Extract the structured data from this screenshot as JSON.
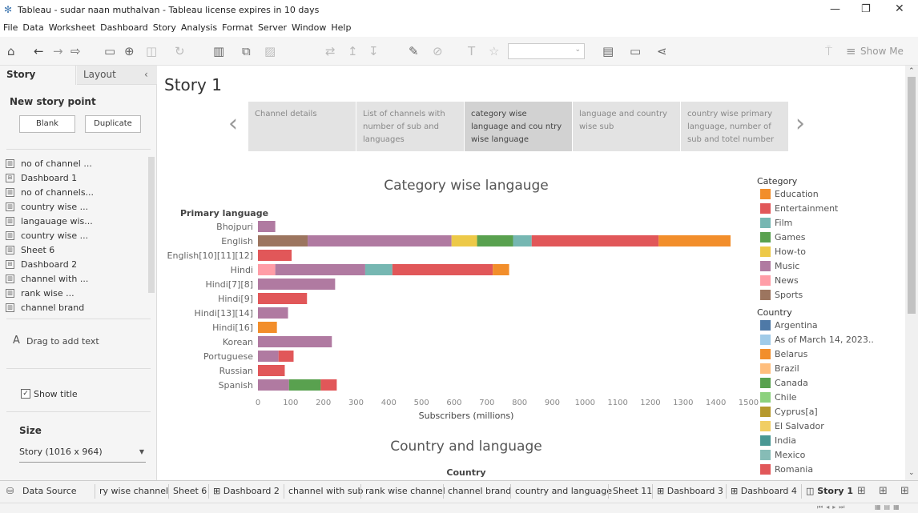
{
  "window": {
    "title": "Tableau - sudar naan muthalvan - Tableau license expires in 10 days"
  },
  "menu": [
    "File",
    "Data",
    "Worksheet",
    "Dashboard",
    "Story",
    "Analysis",
    "Format",
    "Server",
    "Window",
    "Help"
  ],
  "toolbar": {
    "show_me": "Show Me"
  },
  "sidebar": {
    "tabs": [
      "Story",
      "Layout"
    ],
    "new_story_point": "New story point",
    "blank": "Blank",
    "duplicate": "Duplicate",
    "sheets": [
      {
        "label": "no of channel ...",
        "icon": "sheet"
      },
      {
        "label": "Dashboard 1",
        "icon": "dashboard"
      },
      {
        "label": "no of channels...",
        "icon": "sheet"
      },
      {
        "label": "country wise ...",
        "icon": "sheet"
      },
      {
        "label": "langauage wis...",
        "icon": "sheet"
      },
      {
        "label": "country wise ...",
        "icon": "sheet"
      },
      {
        "label": "Sheet 6",
        "icon": "sheet"
      },
      {
        "label": "Dashboard 2",
        "icon": "dashboard"
      },
      {
        "label": "channel with ...",
        "icon": "sheet"
      },
      {
        "label": "rank wise ...",
        "icon": "sheet"
      },
      {
        "label": "channel brand",
        "icon": "sheet"
      }
    ],
    "drag_text": "Drag to add text",
    "show_title": "Show title",
    "size_label": "Size",
    "size_value": "Story (1016 x 964)"
  },
  "story": {
    "title": "Story 1",
    "points": [
      {
        "label": "Channel details",
        "selected": false
      },
      {
        "label": "List of channels with number of sub and languages",
        "selected": false
      },
      {
        "label": "category wise language and cou ntry wise language",
        "selected": true
      },
      {
        "label": "language and country wise sub",
        "selected": false
      },
      {
        "label": "country wise primary language, number of sub and totel number",
        "selected": false
      }
    ],
    "second_chart_title": "Country and language",
    "second_chart_header": "Country"
  },
  "legend": {
    "category_title": "Category",
    "categories": [
      {
        "name": "Education",
        "color": "#f28e2b"
      },
      {
        "name": "Entertainment",
        "color": "#e15759"
      },
      {
        "name": "Film",
        "color": "#76b7b2"
      },
      {
        "name": "Games",
        "color": "#59a14f"
      },
      {
        "name": "How-to",
        "color": "#edc948"
      },
      {
        "name": "Music",
        "color": "#b07aa1"
      },
      {
        "name": "News",
        "color": "#ff9da7"
      },
      {
        "name": "Sports",
        "color": "#9c755f"
      }
    ],
    "country_title": "Country",
    "countries": [
      {
        "name": "Argentina",
        "color": "#4e79a7"
      },
      {
        "name": "As of March 14, 2023..",
        "color": "#a0cbe8"
      },
      {
        "name": "Belarus",
        "color": "#f28e2b"
      },
      {
        "name": "Brazil",
        "color": "#ffbe7d"
      },
      {
        "name": "Canada",
        "color": "#59a14f"
      },
      {
        "name": "Chile",
        "color": "#8cd17d"
      },
      {
        "name": "Cyprus[a]",
        "color": "#b6992d"
      },
      {
        "name": "El Salvador",
        "color": "#f1ce63"
      },
      {
        "name": "India",
        "color": "#499894"
      },
      {
        "name": "Mexico",
        "color": "#86bcb6"
      },
      {
        "name": "Romania",
        "color": "#e15759"
      }
    ]
  },
  "bottom_tabs": [
    "Data Source",
    "ry wise channel",
    "Sheet 6",
    "Dashboard 2",
    "channel with sub",
    "rank wise channel",
    "channel brand",
    "country and language",
    "Sheet 11",
    "Dashboard 3",
    "Dashboard 4",
    "Story 1"
  ],
  "chart_data": {
    "type": "bar",
    "orientation": "horizontal",
    "stacked": true,
    "title": "Category wise langauge",
    "ylabel": "Primary language",
    "xlabel": "Subscribers (millions)",
    "xlim": [
      0,
      1500
    ],
    "xticks": [
      0,
      100,
      200,
      300,
      400,
      500,
      600,
      700,
      800,
      900,
      1000,
      1100,
      1200,
      1300,
      1400,
      1500
    ],
    "categories": [
      "Bhojpuri",
      "English",
      "English[10][11][12]",
      "Hindi",
      "Hindi[7][8]",
      "Hindi[9]",
      "Hindi[13][14]",
      "Hindi[16]",
      "Korean",
      "Portuguese",
      "Russian",
      "Spanish"
    ],
    "series": [
      {
        "name": "Sports",
        "values": [
          0,
          152,
          0,
          0,
          0,
          0,
          0,
          0,
          0,
          0,
          0,
          0
        ]
      },
      {
        "name": "News",
        "values": [
          0,
          0,
          0,
          53,
          0,
          0,
          0,
          0,
          0,
          0,
          0,
          0
        ]
      },
      {
        "name": "Music",
        "values": [
          53,
          440,
          0,
          275,
          236,
          0,
          92,
          0,
          226,
          63,
          0,
          95
        ]
      },
      {
        "name": "How-to",
        "values": [
          0,
          78,
          0,
          0,
          0,
          0,
          0,
          0,
          0,
          0,
          0,
          0
        ]
      },
      {
        "name": "Games",
        "values": [
          0,
          110,
          0,
          0,
          0,
          0,
          0,
          0,
          0,
          0,
          0,
          97
        ]
      },
      {
        "name": "Film",
        "values": [
          0,
          57,
          0,
          83,
          0,
          0,
          0,
          0,
          0,
          0,
          0,
          0
        ]
      },
      {
        "name": "Entertainment",
        "values": [
          0,
          388,
          103,
          307,
          0,
          150,
          0,
          0,
          0,
          46,
          82,
          49
        ]
      },
      {
        "name": "Education",
        "values": [
          0,
          220,
          0,
          50,
          0,
          0,
          0,
          58,
          0,
          0,
          0,
          0
        ]
      }
    ]
  }
}
